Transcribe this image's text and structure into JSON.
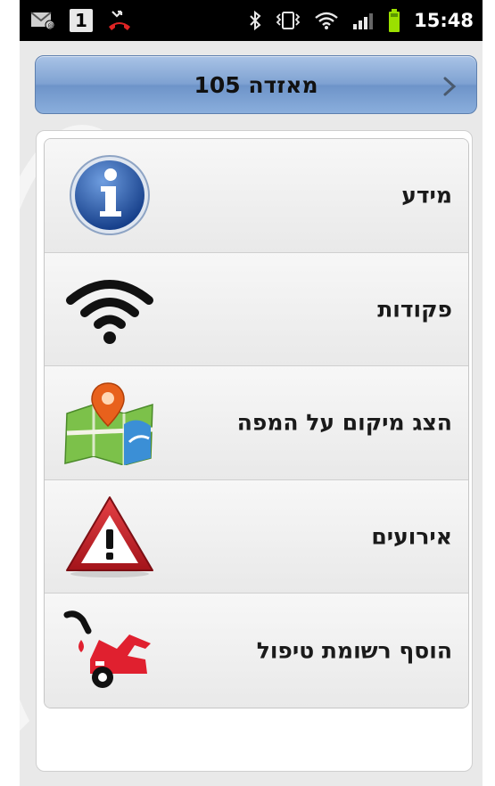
{
  "status_bar": {
    "sim_number": "1",
    "time": "15:48",
    "icons": [
      "email-icon",
      "sim-icon",
      "missed-call-icon",
      "bluetooth-icon",
      "vibrate-icon",
      "wifi-icon",
      "signal-icon",
      "battery-icon"
    ]
  },
  "header": {
    "title": "מאזדה 105",
    "back_icon": "chevron-right-icon"
  },
  "menu": {
    "items": [
      {
        "label": "מידע",
        "icon": "info-icon"
      },
      {
        "label": "פקודות",
        "icon": "wifi-signal-icon"
      },
      {
        "label": "הצג מיקום על המפה",
        "icon": "map-pin-icon"
      },
      {
        "label": "אירועים",
        "icon": "warning-icon"
      },
      {
        "label": "הוסף רשומת טיפול",
        "icon": "car-service-icon"
      }
    ]
  },
  "colors": {
    "title_bar": "#7fa2d2",
    "info_blue": "#2d5ba8",
    "warning_red": "#c62026",
    "car_red": "#e0202f"
  }
}
